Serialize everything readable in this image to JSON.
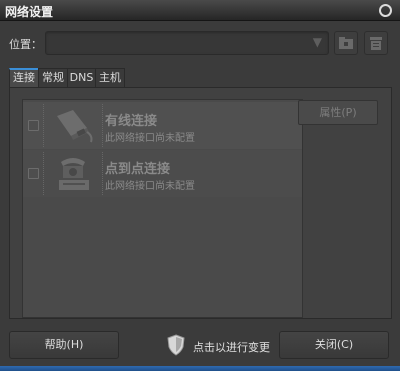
{
  "window": {
    "title": "网络设置"
  },
  "location": {
    "label": "位置：",
    "value": ""
  },
  "tabs": [
    {
      "label": "连接",
      "active": true
    },
    {
      "label": "常规",
      "active": false
    },
    {
      "label": "DNS",
      "active": false
    },
    {
      "label": "主机",
      "active": false
    }
  ],
  "connections": [
    {
      "title": "有线连接",
      "status": "此网络接口尚未配置",
      "icon": "ethernet-icon"
    },
    {
      "title": "点到点连接",
      "status": "此网络接口尚未配置",
      "icon": "phone-modem-icon"
    }
  ],
  "buttons": {
    "properties": "属性(P)",
    "help": "帮助(H)",
    "close": "关闭(C)"
  },
  "unlock": {
    "text": "点击以进行变更",
    "icon": "shield-icon"
  },
  "colors": {
    "accent": "#3b8fd8",
    "bottom_bar": "#2e6ab0"
  }
}
